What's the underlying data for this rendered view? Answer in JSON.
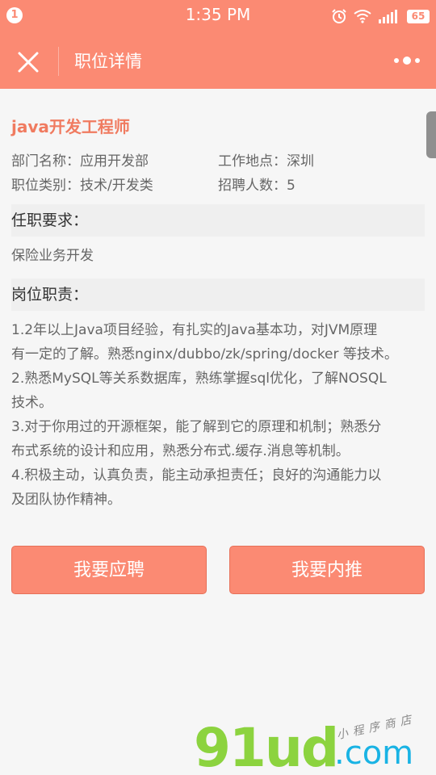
{
  "status_bar": {
    "notification_count": "1",
    "time": "1:35 PM",
    "battery": "65",
    "icons": [
      "alarm-icon",
      "wifi-icon",
      "signal-icon",
      "battery-icon"
    ]
  },
  "nav": {
    "title": "职位详情",
    "close_icon": "close-icon",
    "more_icon": "more-dots-icon"
  },
  "job": {
    "title": "java开发工程师",
    "department": "部门名称：应用开发部",
    "location": "工作地点：深圳",
    "category": "职位类别：技术/开发类",
    "headcount": "招聘人数：5"
  },
  "requirements": {
    "heading": "任职要求：",
    "text": "保险业务开发"
  },
  "duties": {
    "heading": "岗位职责：",
    "lines": [
      "1.2年以上Java项目经验，有扎实的Java基本功，对JVM原理",
      "有一定的了解。熟悉nginx/dubbo/zk/spring/docker 等技术。",
      "2.熟悉MySQL等关系数据库，熟练掌握sql优化，了解NOSQL",
      "技术。",
      "3.对于你用过的开源框架，能了解到它的原理和机制；熟悉分",
      "布式系统的设计和应用，熟悉分布式.缓存.消息等机制。",
      "4.积极主动，认真负责，能主动承担责任；良好的沟通能力以",
      "及团队协作精神。"
    ]
  },
  "actions": {
    "apply_label": "我要应聘",
    "refer_label": "我要内推"
  },
  "watermark": {
    "brand": "91ud",
    "domain": ".com",
    "tagline": "小程序商店"
  },
  "colors": {
    "accent": "#fb8a73",
    "title": "#f07b60",
    "background": "#f6f6f6"
  }
}
